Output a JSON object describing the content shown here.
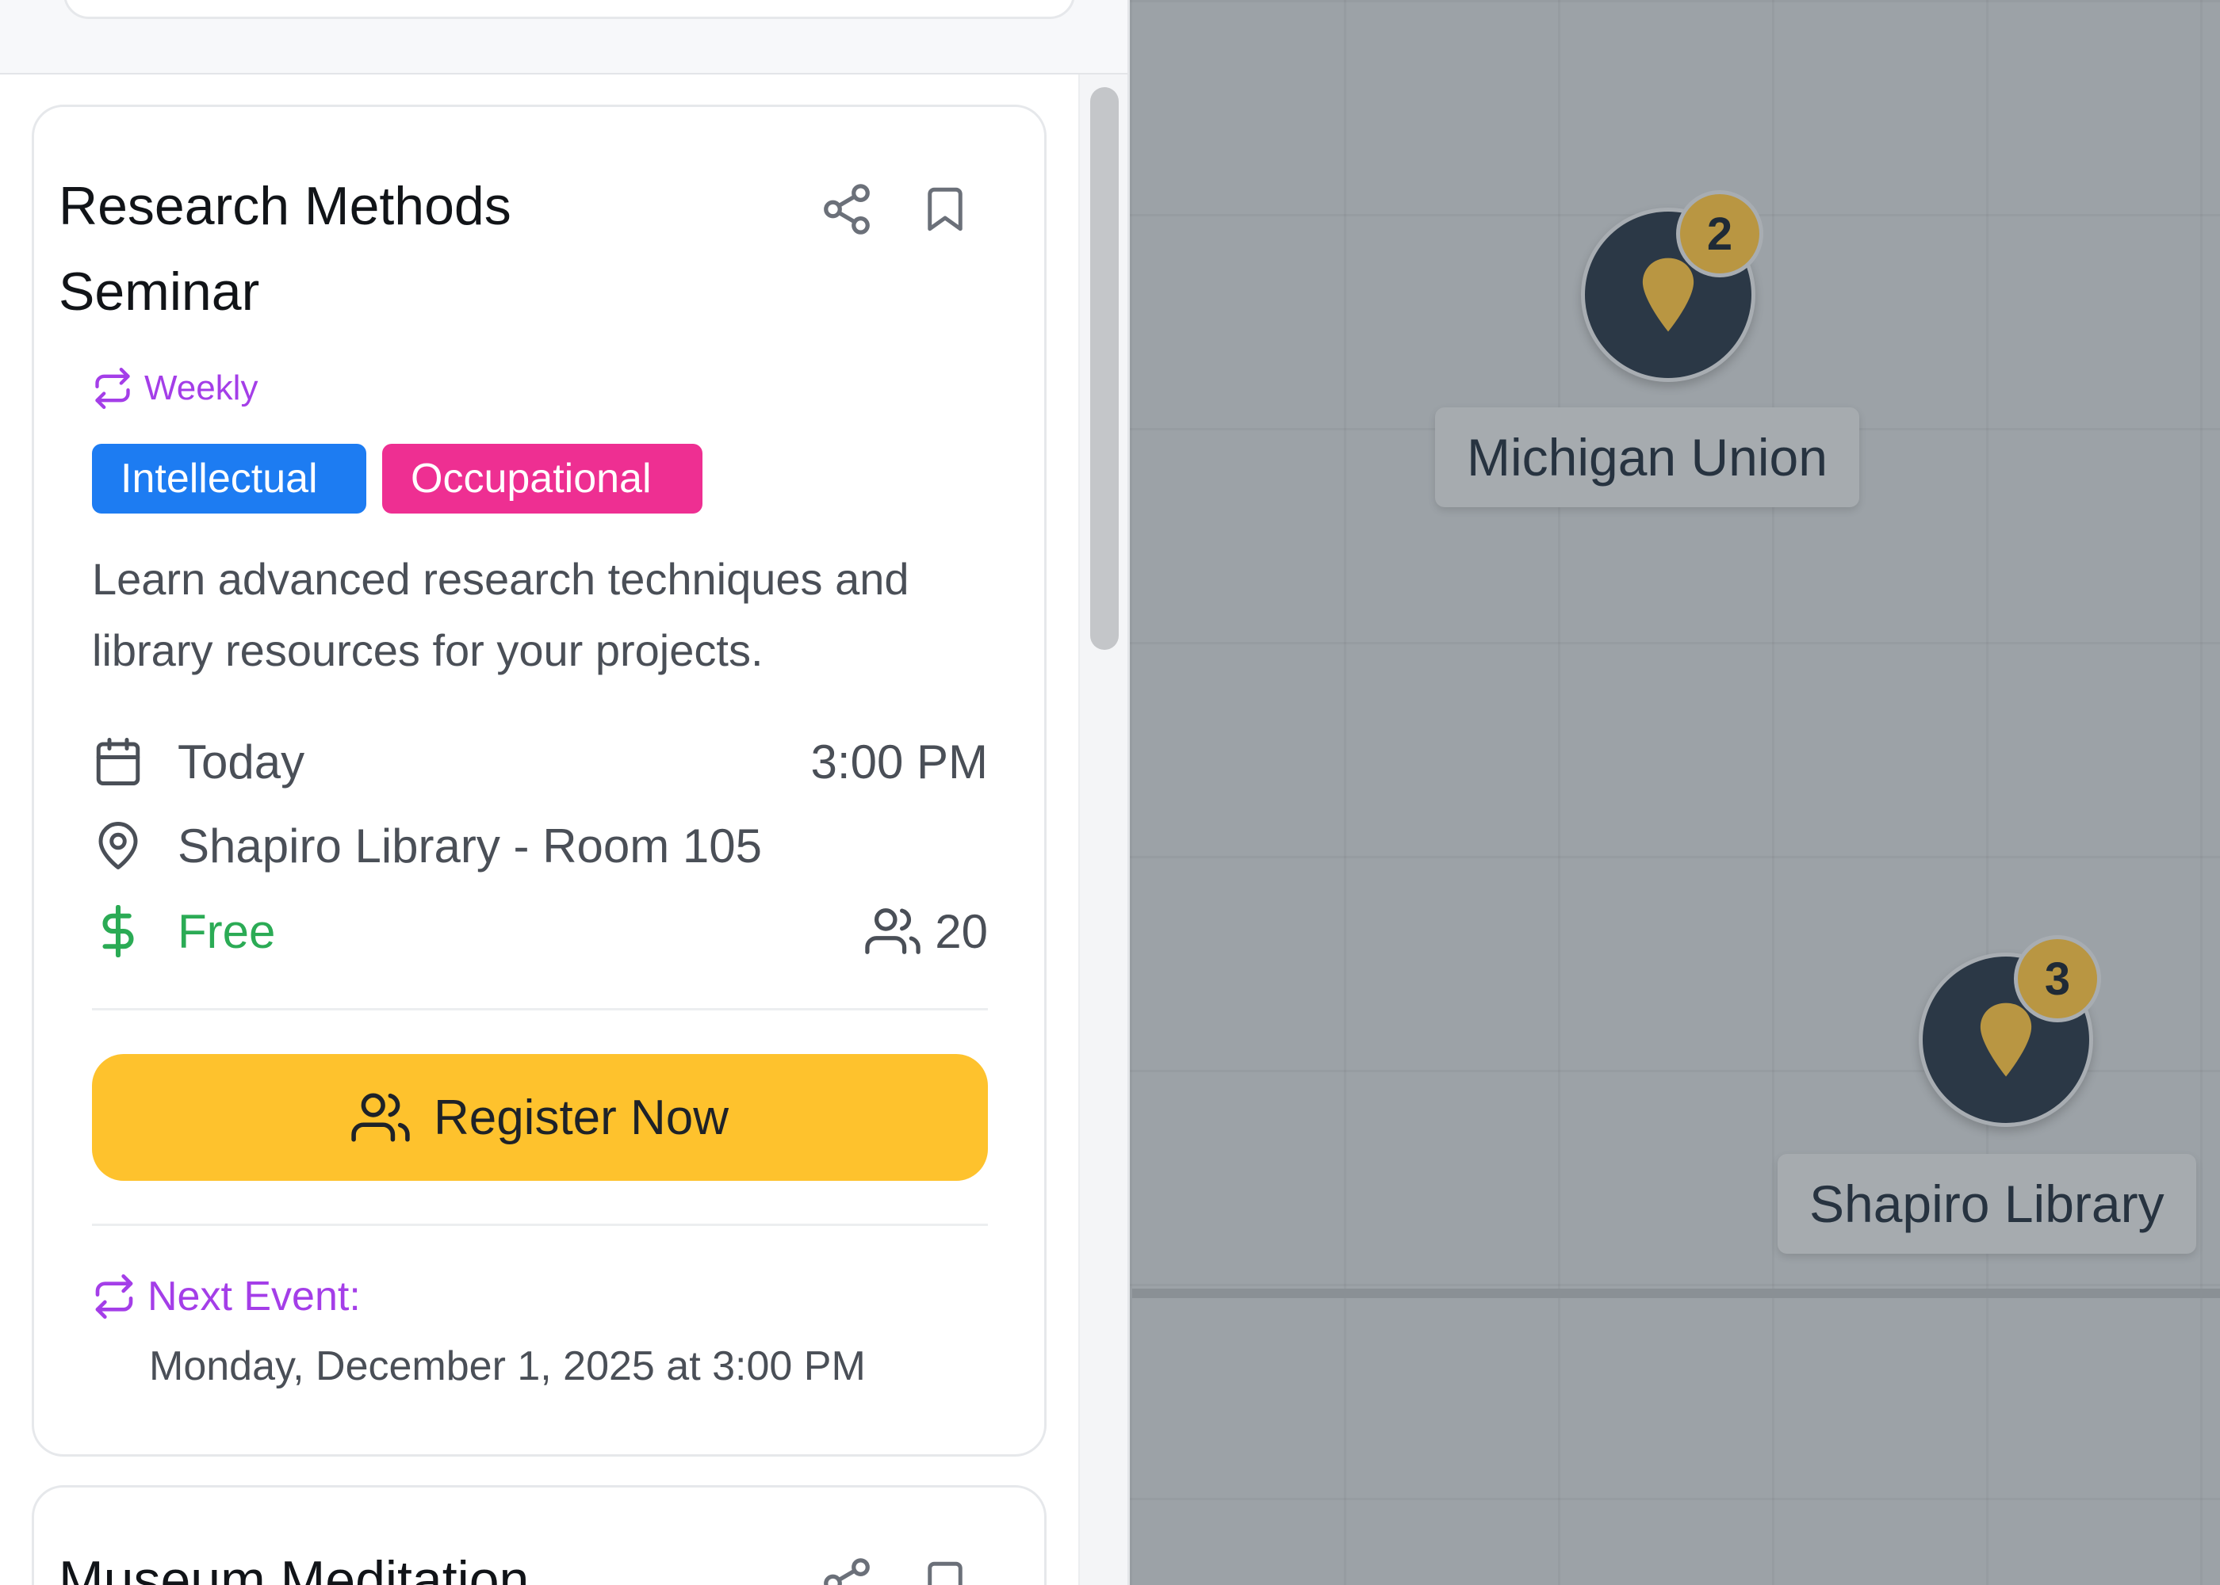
{
  "events": [
    {
      "title": "Research Methods Seminar",
      "recurrence": "Weekly",
      "tags": [
        {
          "label": "Intellectual",
          "color": "#1d7cf2"
        },
        {
          "label": "Occupational",
          "color": "#ee2f92"
        }
      ],
      "description": "Learn advanced research techniques and library resources for your projects.",
      "date": "Today",
      "time": "3:00 PM",
      "location": "Shapiro Library - Room 105",
      "price": "Free",
      "capacity": "20",
      "register_label": "Register Now",
      "next_event_label": "Next Event:",
      "next_event_date": "Monday, December 1, 2025 at 3:00 PM"
    },
    {
      "title": "Museum Meditation"
    }
  ],
  "map": {
    "markers": [
      {
        "label": "Michigan Union",
        "count": "2"
      },
      {
        "label": "Shapiro Library",
        "count": "3"
      }
    ]
  },
  "colors": {
    "accent": "#fec22d",
    "recurrence": "#a43ee8",
    "free": "#2bab55",
    "marker": "#2b3846",
    "marker_pin": "#b99642"
  }
}
